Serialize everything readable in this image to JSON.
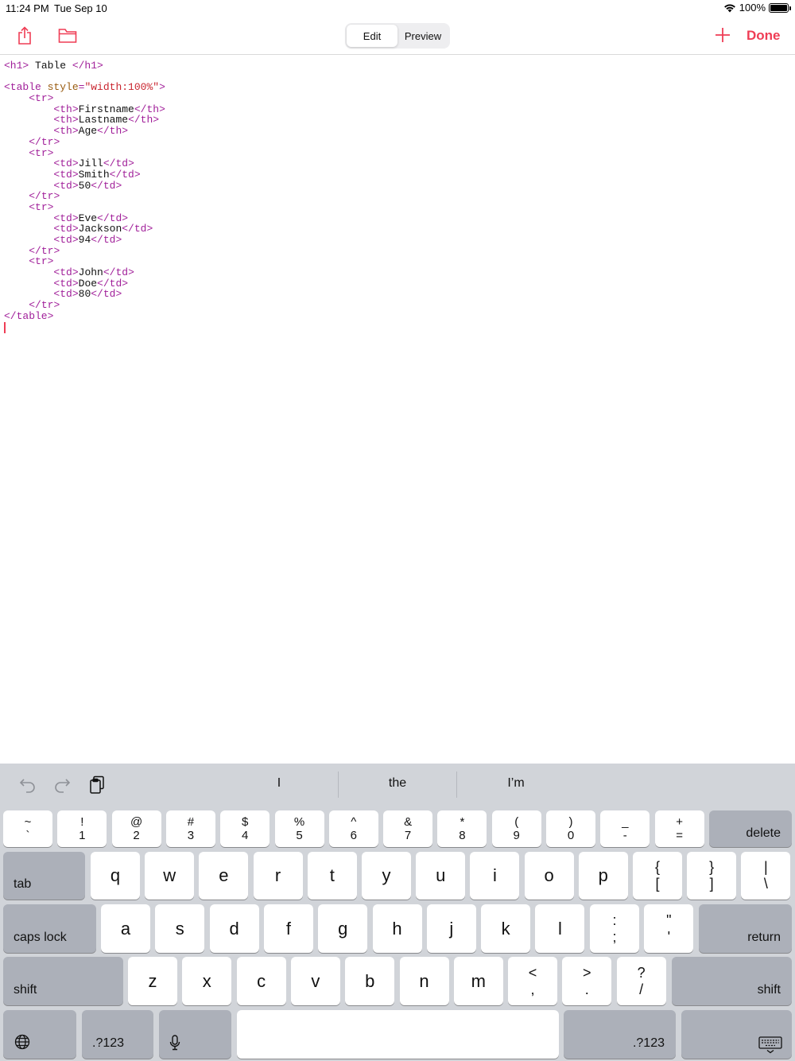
{
  "status": {
    "time": "11:24 PM",
    "date": "Tue Sep 10",
    "battery": "100%"
  },
  "toolbar": {
    "share_icon": "share-icon",
    "folder_icon": "folder-icon",
    "tabs": [
      {
        "label": "Edit",
        "active": true
      },
      {
        "label": "Preview",
        "active": false
      }
    ],
    "plus_icon": "plus-icon",
    "done_label": "Done",
    "accent_color": "#ef3d55"
  },
  "editor": {
    "lines": [
      "<h1> Table </h1>",
      "",
      "<table style=\"width:100%\">",
      "    <tr>",
      "        <th>Firstname</th>",
      "        <th>Lastname</th>",
      "        <th>Age</th>",
      "    </tr>",
      "    <tr>",
      "        <td>Jill</td>",
      "        <td>Smith</td>",
      "        <td>50</td>",
      "    </tr>",
      "    <tr>",
      "        <td>Eve</td>",
      "        <td>Jackson</td>",
      "        <td>94</td>",
      "    </tr>",
      "    <tr>",
      "        <td>John</td>",
      "        <td>Doe</td>",
      "        <td>80</td>",
      "    </tr>",
      "</table>"
    ]
  },
  "keyboard": {
    "tools": {
      "undo_icon": "undo-icon",
      "redo_icon": "redo-icon",
      "paste_icon": "paste-icon"
    },
    "suggestions": [
      "I",
      "the",
      "I’m"
    ],
    "number_row": [
      {
        "top": "~",
        "bottom": "`"
      },
      {
        "top": "!",
        "bottom": "1"
      },
      {
        "top": "@",
        "bottom": "2"
      },
      {
        "top": "#",
        "bottom": "3"
      },
      {
        "top": "$",
        "bottom": "4"
      },
      {
        "top": "%",
        "bottom": "5"
      },
      {
        "top": "^",
        "bottom": "6"
      },
      {
        "top": "&",
        "bottom": "7"
      },
      {
        "top": "*",
        "bottom": "8"
      },
      {
        "top": "(",
        "bottom": "9"
      },
      {
        "top": ")",
        "bottom": "0"
      },
      {
        "top": "_",
        "bottom": "-"
      },
      {
        "top": "+",
        "bottom": "="
      }
    ],
    "delete_label": "delete",
    "tab_label": "tab",
    "row_q": [
      "q",
      "w",
      "e",
      "r",
      "t",
      "y",
      "u",
      "i",
      "o",
      "p"
    ],
    "row_q_symbols": [
      {
        "top": "{",
        "bottom": "["
      },
      {
        "top": "}",
        "bottom": "]"
      },
      {
        "top": "|",
        "bottom": "\\"
      }
    ],
    "caps_label": "caps lock",
    "row_a": [
      "a",
      "s",
      "d",
      "f",
      "g",
      "h",
      "j",
      "k",
      "l"
    ],
    "row_a_symbols": [
      {
        "top": ":",
        "bottom": ";"
      },
      {
        "top": "\"",
        "bottom": "'"
      }
    ],
    "return_label": "return",
    "shift_label": "shift",
    "row_z": [
      "z",
      "x",
      "c",
      "v",
      "b",
      "n",
      "m"
    ],
    "row_z_symbols": [
      {
        "top": "<",
        "bottom": ","
      },
      {
        "top": ">",
        "bottom": "."
      },
      {
        "top": "?",
        "bottom": "/"
      }
    ],
    "globe_icon": "globe-icon",
    "numbers_label": ".?123",
    "mic_icon": "microphone-icon",
    "hide_keyboard_icon": "keyboard-hide-icon"
  }
}
